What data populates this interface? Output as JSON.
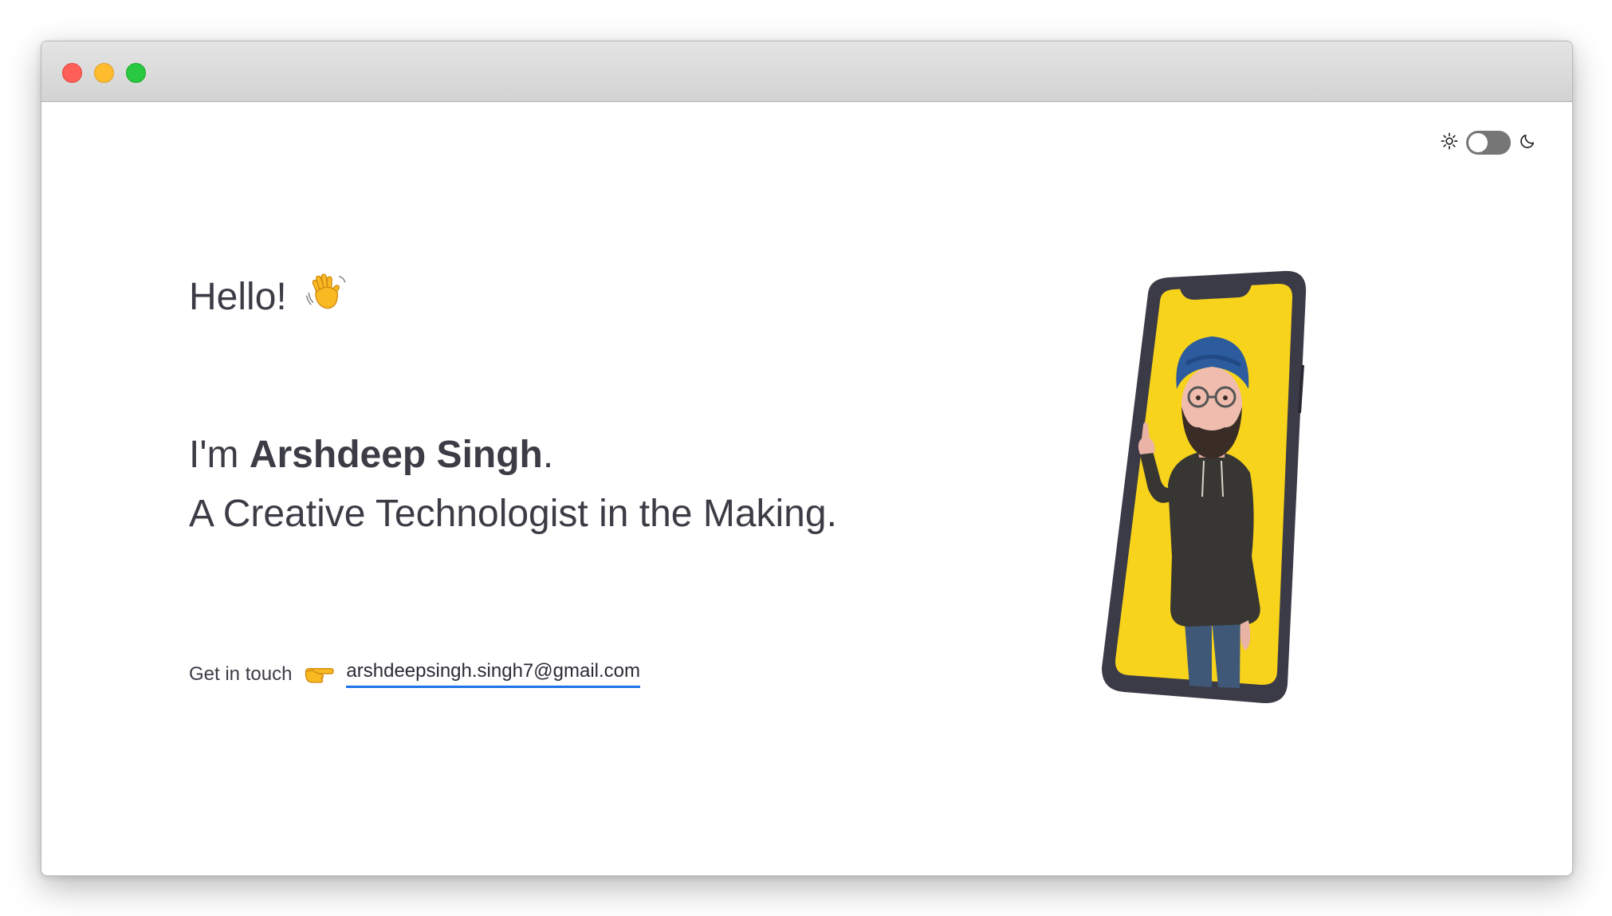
{
  "window": {
    "controls": [
      "close",
      "minimize",
      "maximize"
    ],
    "colors": {
      "close": "#fe5f57",
      "minimize": "#febc2e",
      "maximize": "#28c840"
    }
  },
  "theme_toggle": {
    "light_icon": "sun-icon",
    "dark_icon": "moon-icon",
    "state": "light"
  },
  "hero": {
    "greeting": "Hello!",
    "greeting_icon": "waving-hand-icon",
    "intro_prefix": "I'm ",
    "name": "Arshdeep Singh",
    "intro_suffix": ".",
    "tagline": "A Creative Technologist in the Making."
  },
  "contact": {
    "label": "Get in touch",
    "pointer_icon": "pointing-hand-icon",
    "email": "arshdeepsingh.singh7@gmail.com"
  },
  "illustration": {
    "name": "phone-avatar-illustration",
    "screen_color": "#f7d31c"
  },
  "colors": {
    "text": "#3c3c46",
    "link_underline": "#1a73e8"
  }
}
